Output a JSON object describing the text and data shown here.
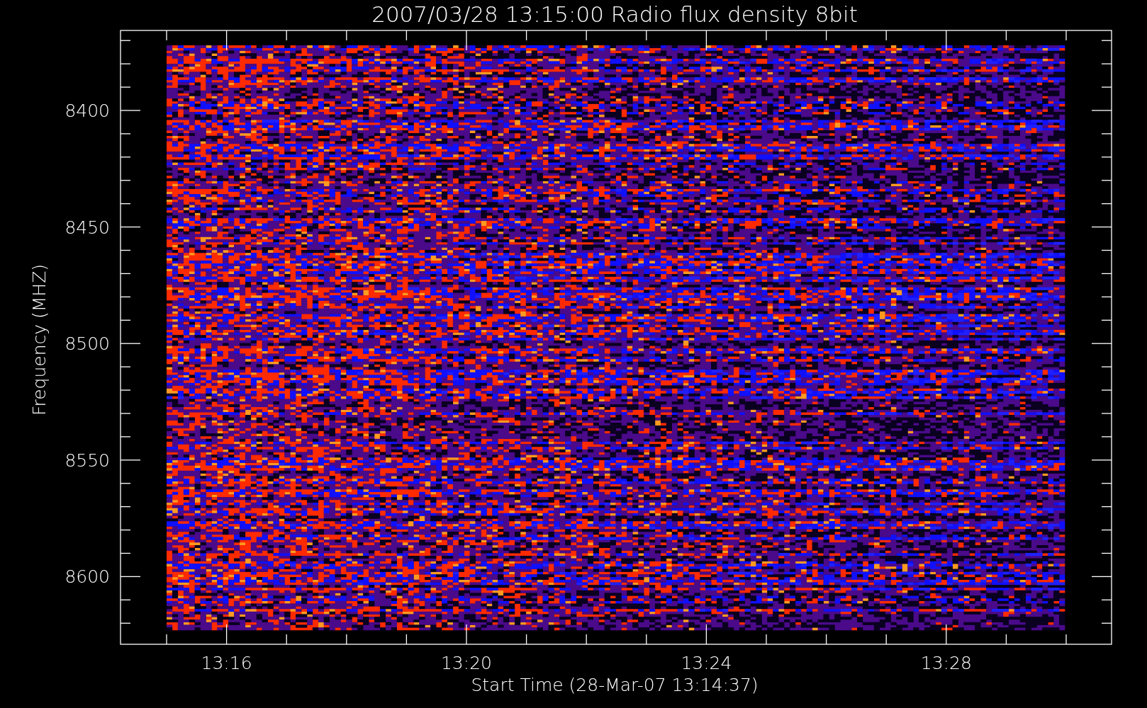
{
  "title": "2007/03/28 13:15:00 Radio flux density 8bit",
  "plot": {
    "y_axis": {
      "label": "Frequency (MHZ)",
      "ticks": [
        "8400",
        "8450",
        "8500",
        "8550",
        "8600"
      ]
    },
    "x_axis": {
      "label": "Start Time (28-Mar-07 13:14:37)",
      "ticks": [
        "13:16",
        "13:20",
        "13:24",
        "13:28"
      ]
    }
  }
}
